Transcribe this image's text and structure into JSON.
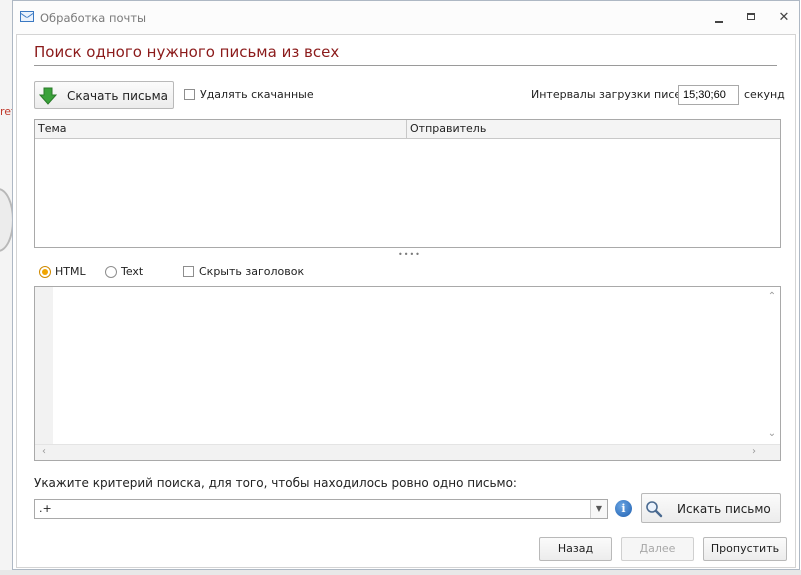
{
  "window": {
    "title": "Обработка почты"
  },
  "background": {
    "left_edge_text": "ref"
  },
  "page": {
    "heading": "Поиск одного нужного письма из всех"
  },
  "toolbar": {
    "download_button": "Скачать письма",
    "delete_checkbox_label": "Удалять скачанные",
    "delete_checked": false,
    "interval_label": "Интервалы загрузки писем:",
    "interval_value": "15;30;60",
    "interval_unit": "секунд"
  },
  "mail_list": {
    "columns": [
      "Тема",
      "Отправитель"
    ],
    "rows": []
  },
  "view_mode": {
    "options": [
      {
        "label": "HTML",
        "selected": true
      },
      {
        "label": "Text",
        "selected": false
      }
    ],
    "hide_header_label": "Скрыть заголовок",
    "hide_header_checked": false
  },
  "search": {
    "prompt": "Укажите критерий поиска, для того, чтобы находилось ровно одно письмо:",
    "value": ".+",
    "search_button": "Искать письмо"
  },
  "footer": {
    "back": "Назад",
    "next": "Далее",
    "next_enabled": false,
    "skip": "Пропустить"
  },
  "colors": {
    "heading": "#8b1a1a",
    "accent_radio": "#f0a400",
    "download_arrow": "#3aa23a",
    "info_icon": "#1f5fb0"
  },
  "icons": {
    "download": "download-arrow-icon",
    "search": "magnifier-icon",
    "info": "info-icon",
    "dropdown": "chevron-down-icon"
  }
}
